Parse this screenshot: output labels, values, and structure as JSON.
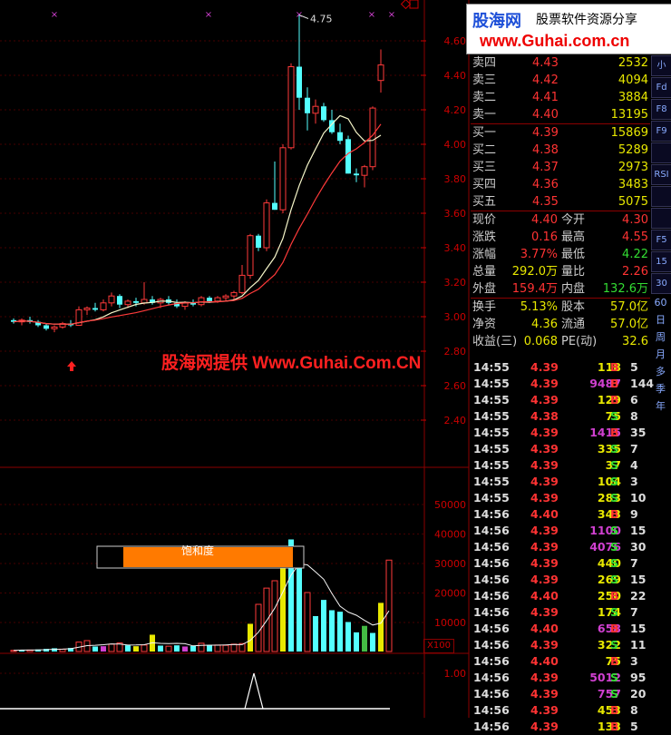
{
  "logo": {
    "brand": "股海网",
    "tagline": "股票软件资源分享",
    "url": "www.Guhai.com.cn"
  },
  "watermark": "股海网提供 Www.Guhai.Com.CN",
  "price_axis": [
    "4.60",
    "4.40",
    "4.20",
    "4.00",
    "3.80",
    "3.60",
    "3.40",
    "3.20",
    "3.00",
    "2.80",
    "2.60",
    "2.40"
  ],
  "volume_axis": [
    "50000",
    "40000",
    "30000",
    "20000",
    "10000"
  ],
  "indicator_axis": [
    "1.00"
  ],
  "chart": {
    "high_marker": "4.75",
    "saturation_label": "饱和度",
    "volume_unit": "X100",
    "candles": [
      {
        "o": 2.98,
        "h": 2.99,
        "l": 2.96,
        "c": 2.97
      },
      {
        "o": 2.97,
        "h": 2.99,
        "l": 2.95,
        "c": 2.98
      },
      {
        "o": 2.98,
        "h": 3.0,
        "l": 2.96,
        "c": 2.97
      },
      {
        "o": 2.97,
        "h": 2.98,
        "l": 2.94,
        "c": 2.95
      },
      {
        "o": 2.95,
        "h": 2.96,
        "l": 2.92,
        "c": 2.93
      },
      {
        "o": 2.93,
        "h": 2.95,
        "l": 2.91,
        "c": 2.94
      },
      {
        "o": 2.94,
        "h": 2.97,
        "l": 2.93,
        "c": 2.96
      },
      {
        "o": 2.96,
        "h": 2.98,
        "l": 2.94,
        "c": 2.95
      },
      {
        "o": 2.95,
        "h": 3.06,
        "l": 2.95,
        "c": 3.04
      },
      {
        "o": 3.04,
        "h": 3.06,
        "l": 3.01,
        "c": 3.05
      },
      {
        "o": 3.05,
        "h": 3.08,
        "l": 3.03,
        "c": 3.04
      },
      {
        "o": 3.04,
        "h": 3.1,
        "l": 3.03,
        "c": 3.08
      },
      {
        "o": 3.08,
        "h": 3.14,
        "l": 3.06,
        "c": 3.12
      },
      {
        "o": 3.12,
        "h": 3.13,
        "l": 3.05,
        "c": 3.07
      },
      {
        "o": 3.07,
        "h": 3.1,
        "l": 3.05,
        "c": 3.09
      },
      {
        "o": 3.09,
        "h": 3.11,
        "l": 3.06,
        "c": 3.08
      },
      {
        "o": 3.08,
        "h": 3.2,
        "l": 3.07,
        "c": 3.1
      },
      {
        "o": 3.1,
        "h": 3.12,
        "l": 3.07,
        "c": 3.08
      },
      {
        "o": 3.08,
        "h": 3.11,
        "l": 3.05,
        "c": 3.1
      },
      {
        "o": 3.1,
        "h": 3.12,
        "l": 3.07,
        "c": 3.08
      },
      {
        "o": 3.08,
        "h": 3.1,
        "l": 3.05,
        "c": 3.06
      },
      {
        "o": 3.06,
        "h": 3.09,
        "l": 3.04,
        "c": 3.08
      },
      {
        "o": 3.08,
        "h": 3.1,
        "l": 3.06,
        "c": 3.07
      },
      {
        "o": 3.07,
        "h": 3.12,
        "l": 3.06,
        "c": 3.11
      },
      {
        "o": 3.11,
        "h": 3.12,
        "l": 3.08,
        "c": 3.09
      },
      {
        "o": 3.09,
        "h": 3.12,
        "l": 3.08,
        "c": 3.11
      },
      {
        "o": 3.11,
        "h": 3.13,
        "l": 3.09,
        "c": 3.12
      },
      {
        "o": 3.12,
        "h": 3.15,
        "l": 3.1,
        "c": 3.14
      },
      {
        "o": 3.14,
        "h": 3.3,
        "l": 3.13,
        "c": 3.24
      },
      {
        "o": 3.24,
        "h": 3.48,
        "l": 3.22,
        "c": 3.47
      },
      {
        "o": 3.47,
        "h": 3.48,
        "l": 3.38,
        "c": 3.4
      },
      {
        "o": 3.4,
        "h": 3.68,
        "l": 3.38,
        "c": 3.66
      },
      {
        "o": 3.66,
        "h": 3.9,
        "l": 3.62,
        "c": 3.62
      },
      {
        "o": 3.62,
        "h": 4.0,
        "l": 3.6,
        "c": 3.98
      },
      {
        "o": 3.98,
        "h": 4.47,
        "l": 3.97,
        "c": 4.45
      },
      {
        "o": 4.45,
        "h": 4.75,
        "l": 4.2,
        "c": 4.27
      },
      {
        "o": 4.27,
        "h": 4.33,
        "l": 4.08,
        "c": 4.18
      },
      {
        "o": 4.18,
        "h": 4.26,
        "l": 4.12,
        "c": 4.22
      },
      {
        "o": 4.22,
        "h": 4.24,
        "l": 4.13,
        "c": 4.14
      },
      {
        "o": 4.14,
        "h": 4.2,
        "l": 4.06,
        "c": 4.07
      },
      {
        "o": 4.07,
        "h": 4.12,
        "l": 4.0,
        "c": 4.02
      },
      {
        "o": 4.03,
        "h": 4.05,
        "l": 3.83,
        "c": 3.83
      },
      {
        "o": 3.83,
        "h": 3.86,
        "l": 3.78,
        "c": 3.82
      },
      {
        "o": 3.82,
        "h": 3.88,
        "l": 3.75,
        "c": 3.87
      },
      {
        "o": 3.87,
        "h": 4.22,
        "l": 3.85,
        "c": 4.21
      },
      {
        "o": 4.37,
        "h": 4.55,
        "l": 4.3,
        "c": 4.46
      }
    ],
    "volumes": [
      400,
      600,
      500,
      700,
      900,
      1100,
      800,
      1200,
      3200,
      3700,
      1700,
      1800,
      2500,
      2900,
      2100,
      1800,
      2200,
      5700,
      2000,
      1800,
      2100,
      1700,
      1900,
      2800,
      2200,
      2200,
      2100,
      2500,
      2700,
      9400,
      16000,
      21500,
      24000,
      30000,
      38000,
      35000,
      20000,
      12000,
      17500,
      14000,
      13500,
      10000,
      6500,
      8700,
      6300,
      16500,
      31000
    ],
    "volume_colors": [
      "rc",
      "c",
      "rc",
      "c",
      "c",
      "c",
      "rc",
      "c",
      "rc",
      "rc",
      "c",
      "m",
      "rc",
      "rc",
      "c",
      "y",
      "rc",
      "y",
      "c",
      "rc",
      "c",
      "m",
      "c",
      "rc",
      "c",
      "rc",
      "rc",
      "rc",
      "rc",
      "y",
      "rc",
      "rc",
      "rc",
      "y",
      "c",
      "c",
      "rc",
      "c",
      "c",
      "c",
      "c",
      "c",
      "c",
      "g",
      "c",
      "y",
      "rc"
    ]
  },
  "quotes": {
    "asks": [
      {
        "label": "卖四",
        "price": "4.43",
        "vol": "2532"
      },
      {
        "label": "卖三",
        "price": "4.42",
        "vol": "4094"
      },
      {
        "label": "卖二",
        "price": "4.41",
        "vol": "3884"
      },
      {
        "label": "卖一",
        "price": "4.40",
        "vol": "13195"
      }
    ],
    "bids": [
      {
        "label": "买一",
        "price": "4.39",
        "vol": "15869"
      },
      {
        "label": "买二",
        "price": "4.38",
        "vol": "5289"
      },
      {
        "label": "买三",
        "price": "4.37",
        "vol": "2973"
      },
      {
        "label": "买四",
        "price": "4.36",
        "vol": "3483"
      },
      {
        "label": "买五",
        "price": "4.35",
        "vol": "5075"
      }
    ],
    "stats": [
      {
        "l1": "现价",
        "v1": "4.40",
        "c1": "#ff3333",
        "l2": "今开",
        "v2": "4.30",
        "c2": "#ff3333"
      },
      {
        "l1": "涨跌",
        "v1": "0.16",
        "c1": "#ff3333",
        "l2": "最高",
        "v2": "4.55",
        "c2": "#ff3333"
      },
      {
        "l1": "涨幅",
        "v1": "3.77%",
        "c1": "#ff3333",
        "l2": "最低",
        "v2": "4.22",
        "c2": "#33dd33"
      },
      {
        "l1": "总量",
        "v1": "292.0万",
        "c1": "#e8e800",
        "l2": "量比",
        "v2": "2.26",
        "c2": "#ff3333"
      },
      {
        "l1": "外盘",
        "v1": "159.4万",
        "c1": "#ff3333",
        "l2": "内盘",
        "v2": "132.6万",
        "c2": "#33dd33"
      }
    ],
    "stats2": [
      {
        "l1": "换手",
        "v1": "5.13%",
        "c1": "#e8e800",
        "l2": "股本",
        "v2": "57.0亿",
        "c2": "#e8e800"
      },
      {
        "l1": "净资",
        "v1": "4.36",
        "c1": "#e8e800",
        "l2": "流通",
        "v2": "57.0亿",
        "c2": "#e8e800"
      },
      {
        "l1": "收益(三)",
        "v1": "0.068",
        "c1": "#e8e800",
        "l2": "PE(动)",
        "v2": "32.6",
        "c2": "#e8e800"
      }
    ]
  },
  "trades": [
    {
      "t": "14:55",
      "p": "4.39",
      "v": "118",
      "bs": "B",
      "n": "5"
    },
    {
      "t": "14:55",
      "p": "4.39",
      "v": "9487",
      "bs": "B",
      "n": "144"
    },
    {
      "t": "14:55",
      "p": "4.39",
      "v": "129",
      "bs": "B",
      "n": "6"
    },
    {
      "t": "14:55",
      "p": "4.38",
      "v": "75",
      "bs": "S",
      "n": "8"
    },
    {
      "t": "14:55",
      "p": "4.39",
      "v": "1415",
      "bs": "B",
      "n": "35"
    },
    {
      "t": "14:55",
      "p": "4.39",
      "v": "335",
      "bs": "S",
      "n": "7"
    },
    {
      "t": "14:55",
      "p": "4.39",
      "v": "37",
      "bs": "S",
      "n": "4"
    },
    {
      "t": "14:55",
      "p": "4.39",
      "v": "104",
      "bs": "S",
      "n": "3"
    },
    {
      "t": "14:55",
      "p": "4.39",
      "v": "283",
      "bs": "S",
      "n": "10"
    },
    {
      "t": "14:56",
      "p": "4.40",
      "v": "343",
      "bs": "B",
      "n": "9"
    },
    {
      "t": "14:56",
      "p": "4.39",
      "v": "1100",
      "bs": "S",
      "n": "15"
    },
    {
      "t": "14:56",
      "p": "4.39",
      "v": "4076",
      "bs": "S",
      "n": "30"
    },
    {
      "t": "14:56",
      "p": "4.39",
      "v": "440",
      "bs": "S",
      "n": "7"
    },
    {
      "t": "14:56",
      "p": "4.39",
      "v": "269",
      "bs": "S",
      "n": "15"
    },
    {
      "t": "14:56",
      "p": "4.40",
      "v": "250",
      "bs": "B",
      "n": "22"
    },
    {
      "t": "14:56",
      "p": "4.39",
      "v": "174",
      "bs": "S",
      "n": "7"
    },
    {
      "t": "14:56",
      "p": "4.40",
      "v": "658",
      "bs": "B",
      "n": "15"
    },
    {
      "t": "14:56",
      "p": "4.39",
      "v": "322",
      "bs": "S",
      "n": "11"
    },
    {
      "t": "14:56",
      "p": "4.40",
      "v": "75",
      "bs": "B",
      "n": "3"
    },
    {
      "t": "14:56",
      "p": "4.39",
      "v": "5012",
      "bs": "S",
      "n": "95"
    },
    {
      "t": "14:56",
      "p": "4.39",
      "v": "757",
      "bs": "S",
      "n": "20"
    },
    {
      "t": "14:56",
      "p": "4.39",
      "v": "453",
      "bs": "B",
      "n": "8"
    },
    {
      "t": "14:56",
      "p": "4.39",
      "v": "133",
      "bs": "B",
      "n": "5"
    }
  ],
  "toolbar": {
    "icons": [
      "chart-icon",
      "candles-icon",
      "compare-icon",
      "fund-icon",
      "f10-icon",
      "f8-icon",
      "bar-icon",
      "rsi-icon",
      "move-icon",
      "pencil-icon",
      "f5-icon"
    ],
    "labels": [
      "小",
      "Fd",
      "F8",
      "F9",
      "",
      "RSI",
      "",
      "",
      "F5",
      "15",
      "30",
      "60",
      "日",
      "周",
      "月",
      "多",
      "季",
      "年"
    ]
  }
}
